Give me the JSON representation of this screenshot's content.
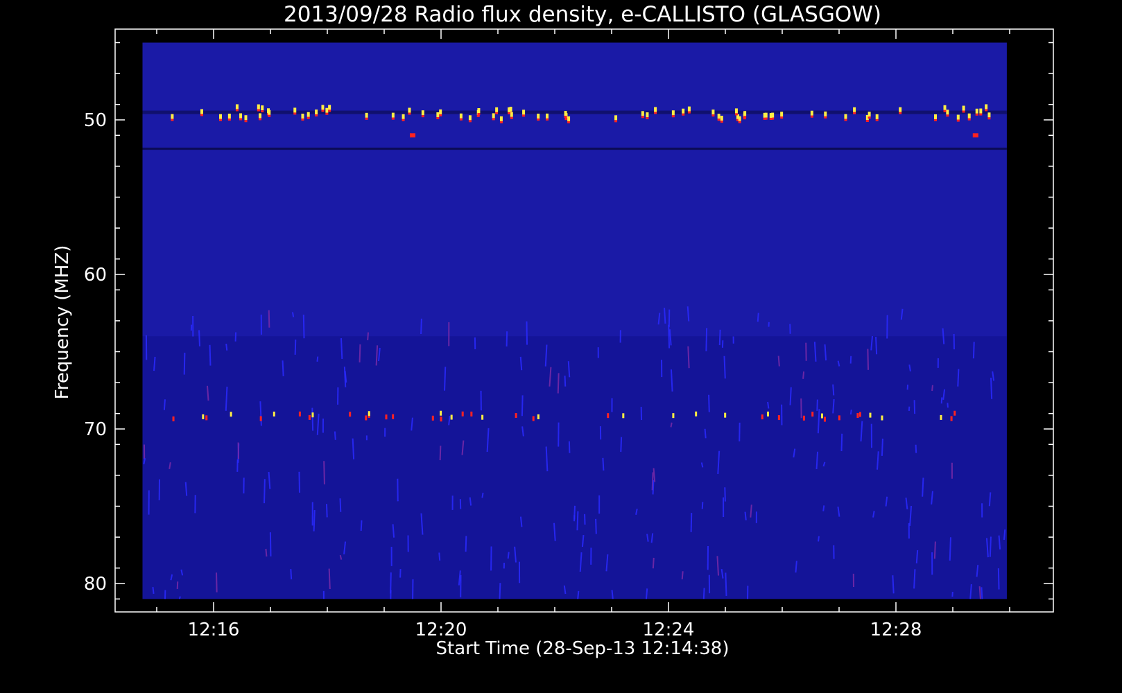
{
  "chart_data": {
    "type": "heatmap",
    "title": "2013/09/28  Radio flux density, e-CALLISTO (GLASGOW)",
    "xlabel": "Start Time (28-Sep-13 12:14:38)",
    "ylabel": "Frequency (MHZ)",
    "x_range": [
      "12:14",
      "12:30"
    ],
    "y_range": [
      45,
      82
    ],
    "y_inverted": true,
    "x_ticks": [
      {
        "label": "12:16",
        "minutes": 16
      },
      {
        "label": "12:20",
        "minutes": 20
      },
      {
        "label": "12:24",
        "minutes": 24
      },
      {
        "label": "12:28",
        "minutes": 28
      }
    ],
    "y_ticks": [
      {
        "label": "50",
        "value": 50
      },
      {
        "label": "60",
        "value": 60
      },
      {
        "label": "70",
        "value": 70
      },
      {
        "label": "80",
        "value": 80
      }
    ],
    "data_extent": {
      "x_start_min": 14.75,
      "x_end_min": 29.95,
      "y_start": 45,
      "y_end": 81
    },
    "features": [
      {
        "name": "interference band",
        "frequency_mhz": 49.8,
        "color": "#ffdd33"
      },
      {
        "name": "interference band",
        "frequency_mhz": 51.8,
        "color": "#000022"
      },
      {
        "name": "interference band",
        "frequency_mhz": 69.2,
        "color": "#cc2222"
      }
    ],
    "colors": {
      "background": "#000000",
      "frame": "#ffffff",
      "base": "#1a1aa6",
      "burst_hot": "#ffee44",
      "burst_warm": "#ff2222",
      "streak": "#2a2aff"
    }
  }
}
